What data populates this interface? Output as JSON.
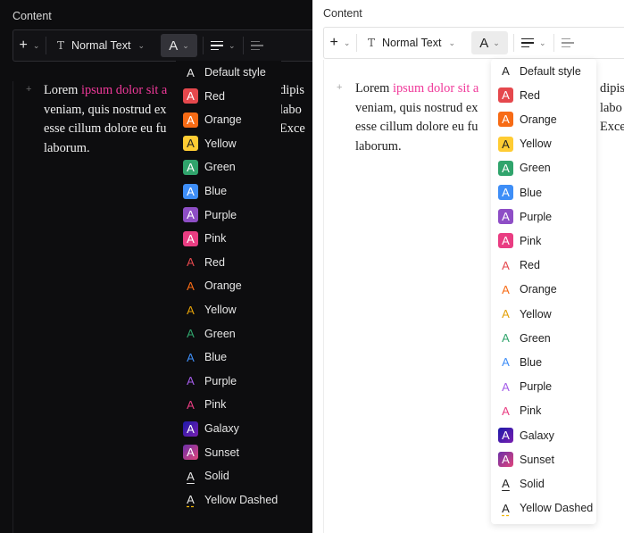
{
  "section_label": "Content",
  "toolbar": {
    "insert_label": "+",
    "chevron": "⌄",
    "text_icon": "T",
    "text_style_label": "Normal Text",
    "color_label": "A"
  },
  "editor": {
    "line1_pre": "Lorem ",
    "line1_hl": "ipsum dolor sit a",
    "line2": "veniam, quis nostrud ex",
    "line3": "esse cillum dolore eu fu",
    "line4": "laborum.",
    "right_dark": [
      "dipis",
      "labo",
      "Exce"
    ],
    "right_light": [
      "dipis",
      "labo",
      "Exce"
    ]
  },
  "menu_items": [
    {
      "label": "Default style",
      "kind": "plain",
      "color": ""
    },
    {
      "label": "Red",
      "kind": "filled",
      "color": "#e5484d"
    },
    {
      "label": "Orange",
      "kind": "filled",
      "color": "#f76b15"
    },
    {
      "label": "Yellow",
      "kind": "filled",
      "color": "#ffcc33"
    },
    {
      "label": "Green",
      "kind": "filled",
      "color": "#30a46c"
    },
    {
      "label": "Blue",
      "kind": "filled",
      "color": "#3e8ef7"
    },
    {
      "label": "Purple",
      "kind": "filled",
      "color": "#8e4ec6"
    },
    {
      "label": "Pink",
      "kind": "filled",
      "color": "#e93d82"
    },
    {
      "label": "Red",
      "kind": "text",
      "color": "#e5484d"
    },
    {
      "label": "Orange",
      "kind": "text",
      "color": "#f76b15"
    },
    {
      "label": "Yellow",
      "kind": "text",
      "color": "#e3a008"
    },
    {
      "label": "Green",
      "kind": "text",
      "color": "#30a46c"
    },
    {
      "label": "Blue",
      "kind": "text",
      "color": "#3e8ef7"
    },
    {
      "label": "Purple",
      "kind": "text",
      "color": "#a35ce8"
    },
    {
      "label": "Pink",
      "kind": "text",
      "color": "#e93d82"
    },
    {
      "label": "Galaxy",
      "kind": "gradient",
      "color": "linear-gradient(135deg,#1c1aa8,#7a1fb0)"
    },
    {
      "label": "Sunset",
      "kind": "gradient",
      "color": "linear-gradient(135deg,#6b2fa8,#e0457b)"
    },
    {
      "label": "Solid",
      "kind": "underline",
      "color": ""
    },
    {
      "label": "Yellow Dashed",
      "kind": "dashed",
      "color": "#f2b705"
    }
  ],
  "colors": {
    "dark_bg": "#0d0d0f",
    "light_bg": "#ffffff",
    "highlight": "#f0399a"
  }
}
